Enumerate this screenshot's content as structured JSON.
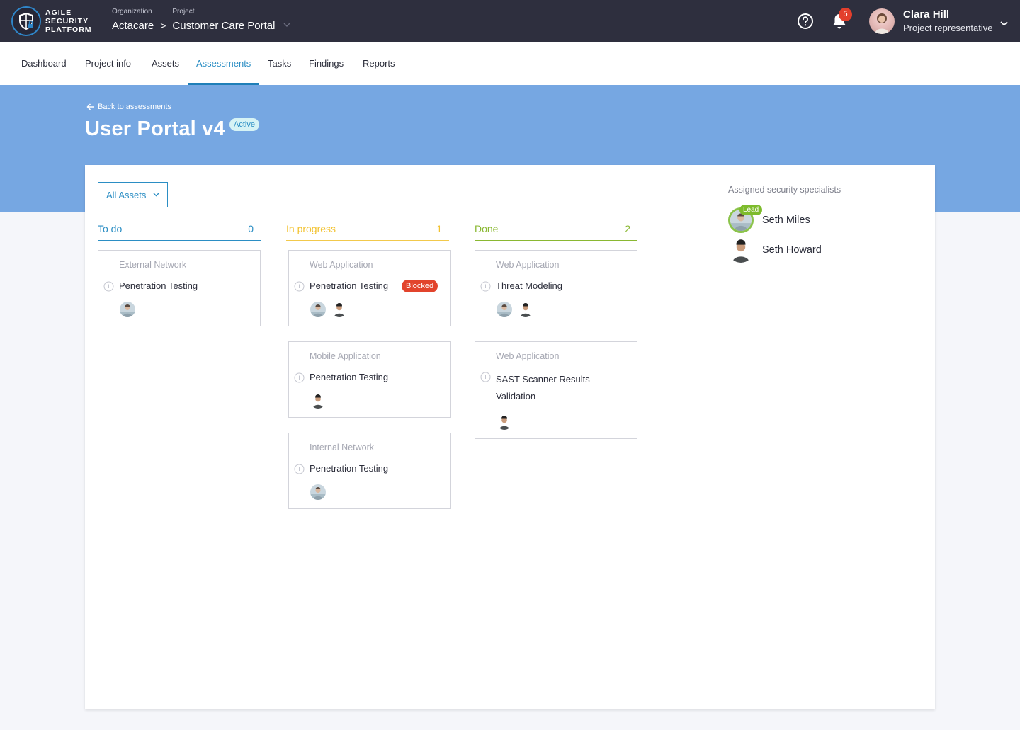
{
  "header": {
    "logo_lines": [
      "AGILE",
      "SECURITY",
      "PLATFORM"
    ],
    "breadcrumb": {
      "organization_label": "Organization",
      "organization_value": "Actacare",
      "separator": ">",
      "project_label": "Project",
      "project_value": "Customer Care Portal"
    },
    "notifications_count": "5",
    "user": {
      "name": "Clara Hill",
      "role": "Project representative"
    },
    "icons": [
      "shield-lock-logo",
      "help-icon",
      "bell-icon",
      "chevron-down-icon"
    ]
  },
  "nav": {
    "tabs": [
      {
        "label": "Dashboard"
      },
      {
        "label": "Project info"
      },
      {
        "label": "Assets"
      },
      {
        "label": "Assessments",
        "active": true
      },
      {
        "label": "Tasks"
      },
      {
        "label": "Findings"
      },
      {
        "label": "Reports"
      }
    ]
  },
  "banner": {
    "back_link": "Back to assessments",
    "title": "User Portal v4",
    "status": "Active"
  },
  "filter": {
    "selected": "All Assets"
  },
  "colors": {
    "todo": "#2b8ec4",
    "in_progress": "#f2c230",
    "done": "#8ab832",
    "blocked": "#e2442c",
    "banner": "#76a7e2",
    "topbar": "#2e2f3e"
  },
  "board": {
    "columns": [
      {
        "title": "To do",
        "count": "0",
        "cards": [
          {
            "asset": "External Network",
            "title": "Penetration Testing",
            "assignees": [
              "Seth Miles"
            ]
          }
        ]
      },
      {
        "title": "In progress",
        "count": "1",
        "cards": [
          {
            "asset": "Web Application",
            "title": "Penetration Testing",
            "badge": "Blocked",
            "assignees": [
              "Seth Miles",
              "Seth Howard"
            ]
          },
          {
            "asset": "Mobile Application",
            "title": "Penetration Testing",
            "assignees": [
              "Seth Howard"
            ]
          },
          {
            "asset": "Internal Network",
            "title": "Penetration Testing",
            "assignees": [
              "Seth Miles"
            ]
          }
        ]
      },
      {
        "title": "Done",
        "count": "2",
        "cards": [
          {
            "asset": "Web Application",
            "title": "Threat Modeling",
            "assignees": [
              "Seth Miles",
              "Seth Howard"
            ]
          },
          {
            "asset": "Web Application",
            "title_lines": [
              "SAST Scanner Results",
              "Validation"
            ],
            "assignees": [
              "Seth Howard"
            ]
          }
        ]
      }
    ]
  },
  "specialists": {
    "title": "Assigned security specialists",
    "lead_label": "Lead",
    "people": [
      {
        "name": "Seth Miles",
        "lead": true
      },
      {
        "name": "Seth Howard",
        "lead": false
      }
    ]
  }
}
